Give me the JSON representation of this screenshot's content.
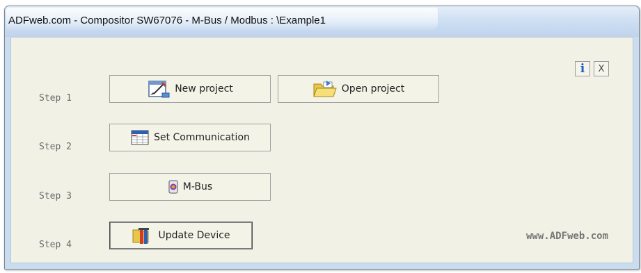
{
  "window": {
    "title": "ADFweb.com - Compositor SW67076 -  M-Bus / Modbus : \\Example1"
  },
  "steps": [
    {
      "label": "Step 1"
    },
    {
      "label": "Step 2"
    },
    {
      "label": "Step 3"
    },
    {
      "label": "Step 4"
    }
  ],
  "buttons": {
    "new_project": {
      "label": "New project",
      "icon": "new-project-icon"
    },
    "open_project": {
      "label": "Open project",
      "icon": "folder-open-icon"
    },
    "set_communication": {
      "label": "Set Communication",
      "icon": "communication-table-icon"
    },
    "mbus": {
      "label": "M-Bus",
      "icon": "mbus-device-icon"
    },
    "update_device": {
      "label": "Update Device",
      "icon": "update-device-icon"
    }
  },
  "toolbar": {
    "info_label": "i",
    "close_label": "X"
  },
  "footer": {
    "website": "www.ADFweb.com"
  },
  "colors": {
    "window_frame": "#c9dcf0",
    "client_background": "#f2f1e6",
    "button_background": "#f4f3e8",
    "info_blue": "#1a5fc8",
    "step_text": "#6a6a6a"
  }
}
